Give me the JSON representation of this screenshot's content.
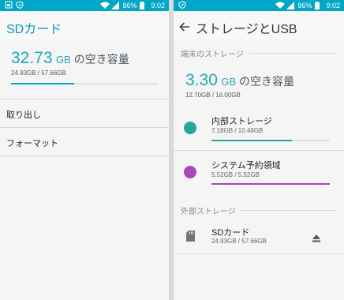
{
  "status_bar": {
    "battery": "86%",
    "time": "9:02"
  },
  "left_screen": {
    "title": "SDカード",
    "free_value": "32.73",
    "free_unit": "GB",
    "free_suffix": " の空き容量",
    "usage_text": "24.93GB / 57.66GB",
    "usage_fraction": 0.43,
    "accent": "#00a7c7",
    "menu": [
      {
        "label": "取り出し"
      },
      {
        "label": "フォーマット"
      }
    ]
  },
  "right_screen": {
    "title": "ストレージとUSB",
    "section_internal": "端末のストレージ",
    "free_value": "3.30",
    "free_unit": "GB",
    "free_suffix": " の空き容量",
    "usage_text": "12.70GB / 16.00GB",
    "items": [
      {
        "name": "内部ストレージ",
        "detail": "7.18GB / 10.48GB",
        "color": "#26a69a",
        "fill_fraction": 0.68
      },
      {
        "name": "システム予約領域",
        "detail": "5.52GB / 5.52GB",
        "color": "#ab47bc",
        "fill_fraction": 1.0
      }
    ],
    "section_external": "外部ストレージ",
    "external": {
      "name": "SDカード",
      "detail": "24.93GB / 57.66GB"
    }
  },
  "icons": [
    "back-arrow-icon",
    "sd-card-icon",
    "eject-icon",
    "wifi-icon",
    "signal-icon",
    "battery-icon",
    "notification-icon"
  ]
}
